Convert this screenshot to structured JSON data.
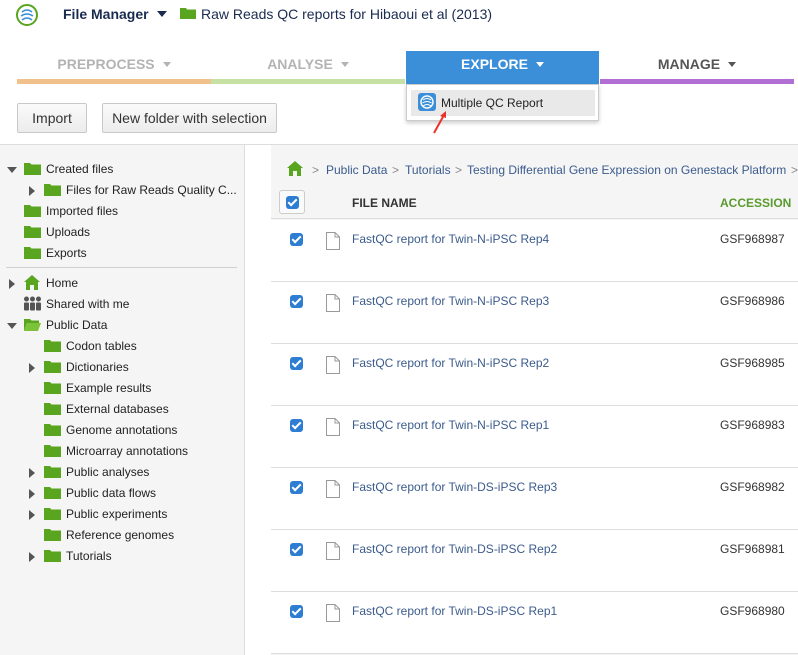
{
  "colors": {
    "accent_blue": "#3a8fd8",
    "folder_green": "#5aa51f",
    "accession_header": "#5a9a2e",
    "preprocess_bar": "#f1c18c",
    "analyse_bar": "#c6e1a4",
    "explore_bar": "#3a8fd8",
    "manage_bar": "#b26fd3"
  },
  "header": {
    "logo_icon": "genestack-logo-icon",
    "app_name": "File Manager",
    "folder_icon": "folder-icon",
    "page_title": "Raw Reads QC reports for Hibaoui et al (2013)"
  },
  "nav": {
    "tabs": [
      {
        "label": "PREPROCESS"
      },
      {
        "label": "ANALYSE"
      },
      {
        "label": "EXPLORE"
      },
      {
        "label": "MANAGE"
      }
    ],
    "dropdown": {
      "item_label": "Multiple QC Report",
      "item_icon": "qc-report-icon"
    }
  },
  "toolbar": {
    "import_label": "Import",
    "new_folder_label": "New folder with selection"
  },
  "sidebar": {
    "items": [
      {
        "label": "Created files"
      },
      {
        "label": "Files for Raw Reads Quality C..."
      },
      {
        "label": "Imported files"
      },
      {
        "label": "Uploads"
      },
      {
        "label": "Exports"
      },
      {
        "label": "Home"
      },
      {
        "label": "Shared with me"
      },
      {
        "label": "Public Data"
      },
      {
        "label": "Codon tables"
      },
      {
        "label": "Dictionaries"
      },
      {
        "label": "Example results"
      },
      {
        "label": "External databases"
      },
      {
        "label": "Genome annotations"
      },
      {
        "label": "Microarray annotations"
      },
      {
        "label": "Public analyses"
      },
      {
        "label": "Public data flows"
      },
      {
        "label": "Public experiments"
      },
      {
        "label": "Reference genomes"
      },
      {
        "label": "Tutorials"
      }
    ]
  },
  "breadcrumb": {
    "items": [
      "Public Data",
      "Tutorials",
      "Testing Differential Gene Expression on Genestack Platform"
    ],
    "separator": ">"
  },
  "table": {
    "columns": {
      "name": "FILE NAME",
      "accession": "ACCESSION"
    },
    "rows": [
      {
        "name": "FastQC report for Twin-N-iPSC Rep4",
        "accession": "GSF968987"
      },
      {
        "name": "FastQC report for Twin-N-iPSC Rep3",
        "accession": "GSF968986"
      },
      {
        "name": "FastQC report for Twin-N-iPSC Rep2",
        "accession": "GSF968985"
      },
      {
        "name": "FastQC report for Twin-N-iPSC Rep1",
        "accession": "GSF968983"
      },
      {
        "name": "FastQC report for Twin-DS-iPSC Rep3",
        "accession": "GSF968982"
      },
      {
        "name": "FastQC report for Twin-DS-iPSC Rep2",
        "accession": "GSF968981"
      },
      {
        "name": "FastQC report for Twin-DS-iPSC Rep1",
        "accession": "GSF968980"
      }
    ]
  }
}
